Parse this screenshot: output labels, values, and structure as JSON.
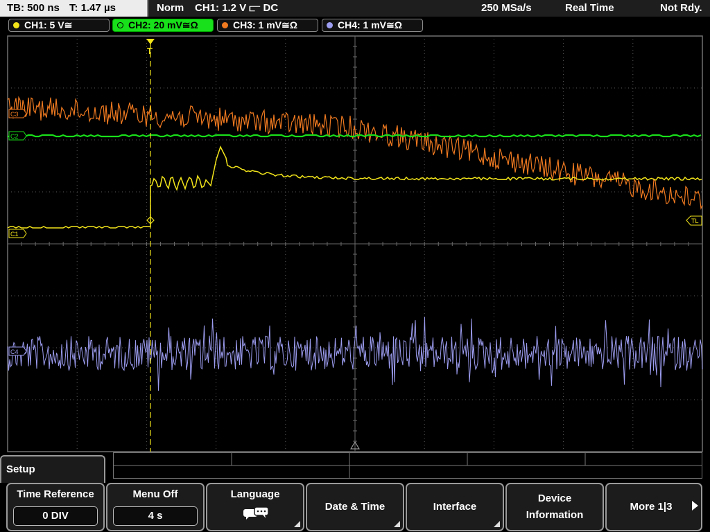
{
  "status_bar": {
    "timebase": "TB: 500 ns",
    "trigger_time": "T: 1.47 µs",
    "mode": "Norm",
    "trigger": "CH1: 1.2 V ⫍ DC",
    "sample_rate": "250 MSa/s",
    "acq_mode": "Real Time",
    "status": "Not Rdy."
  },
  "channels": [
    {
      "label": "CH1: 5 V≅",
      "color": "#f2e41a",
      "active": false
    },
    {
      "label": "CH2: 20 mV≅Ω",
      "color": "#18e01a",
      "active": true
    },
    {
      "label": "CH3: 1 mV≅Ω",
      "color": "#f07a20",
      "active": false
    },
    {
      "label": "CH4: 1 mV≅Ω",
      "color": "#9c9cf0",
      "active": false
    }
  ],
  "markers": {
    "ch3": "C3",
    "ch2": "C2",
    "ch1": "C1",
    "ch4": "C4",
    "trigger_level": "TL",
    "trigger": "T"
  },
  "menu": {
    "title": "Setup",
    "softkeys": [
      {
        "label": "Time Reference",
        "value": "0 DIV"
      },
      {
        "label": "Menu Off",
        "value": "4 s"
      },
      {
        "label": "Language",
        "icon": "speech-bubbles-icon"
      },
      {
        "label": "Date & Time"
      },
      {
        "label": "Interface"
      },
      {
        "label_line1": "Device",
        "label_line2": "Information"
      },
      {
        "label": "More 1|3",
        "icon": "next-page-icon"
      }
    ]
  },
  "colors": {
    "ch1": "#f2e41a",
    "ch2": "#18e01a",
    "ch3": "#f07a20",
    "ch4": "#9c9cf0",
    "grid": "#5a5a5a"
  }
}
